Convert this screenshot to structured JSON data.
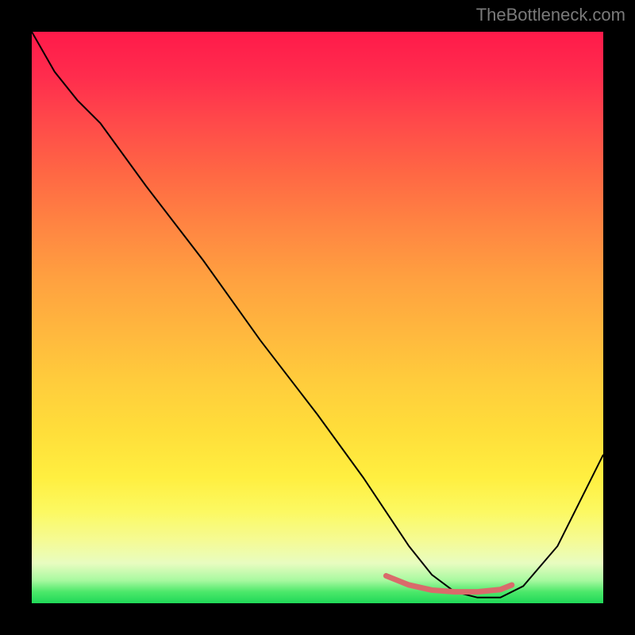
{
  "watermark": "TheBottleneck.com",
  "chart_data": {
    "type": "line",
    "title": "",
    "xlabel": "",
    "ylabel": "",
    "xlim": [
      0,
      100
    ],
    "ylim": [
      0,
      100
    ],
    "grid": false,
    "legend": false,
    "background_gradient": {
      "orientation": "vertical",
      "stops": [
        {
          "pos": 0.0,
          "color": "#ff1a4a"
        },
        {
          "pos": 0.5,
          "color": "#ffb03e"
        },
        {
          "pos": 0.85,
          "color": "#fcf962"
        },
        {
          "pos": 1.0,
          "color": "#1fd858"
        }
      ]
    },
    "series": [
      {
        "name": "bottleneck-curve",
        "color": "#000000",
        "x": [
          0,
          4,
          8,
          12,
          20,
          30,
          40,
          50,
          58,
          62,
          66,
          70,
          74,
          78,
          82,
          86,
          92,
          100
        ],
        "y": [
          100,
          93,
          88,
          84,
          73,
          60,
          46,
          33,
          22,
          16,
          10,
          5,
          2,
          1,
          1,
          3,
          10,
          26
        ]
      }
    ],
    "highlight_segment": {
      "name": "optimal-range",
      "color": "#d96b6b",
      "stroke_width": 7,
      "x": [
        62,
        66,
        70,
        74,
        78,
        82,
        84
      ],
      "y": [
        4.8,
        3.2,
        2.3,
        2.0,
        2.0,
        2.4,
        3.2
      ]
    }
  }
}
